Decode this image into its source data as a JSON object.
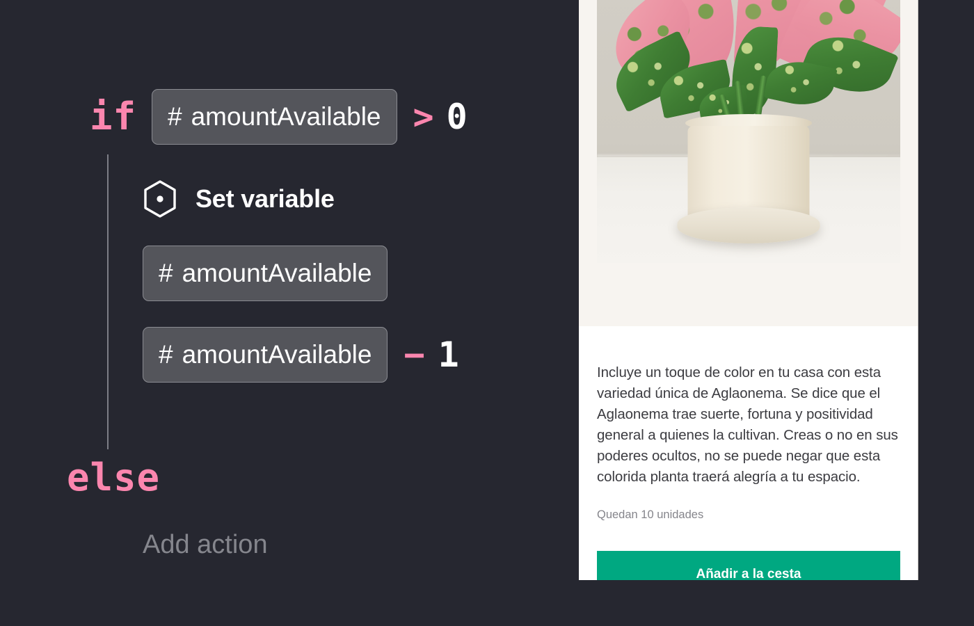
{
  "theme": {
    "background": "#262730",
    "keyword_color": "#fb86ae",
    "chip_background": "#54555b",
    "chip_border": "#8b8c92",
    "muted_text": "#85868d",
    "accent_green": "#00a881",
    "card_media_background": "#f7f4f0"
  },
  "flow": {
    "if_keyword": "if",
    "condition": {
      "variable_prefix": "#",
      "variable_name": "amountAvailable",
      "operator": ">",
      "value": "0"
    },
    "action": {
      "icon": "hexagon-dot-icon",
      "title": "Set variable",
      "target": {
        "variable_prefix": "#",
        "variable_name": "amountAvailable"
      },
      "expression": {
        "variable_prefix": "#",
        "variable_name": "amountAvailable",
        "operator": "−",
        "value": "1"
      }
    },
    "else_keyword": "else",
    "add_action_label": "Add action"
  },
  "product_card": {
    "image_alt": "aglaonema-pink-plant-photo",
    "description": "Incluye un toque de color en tu casa con esta variedad única de Aglaonema. Se dice que el Aglaonema trae suerte, fortuna y positividad general a quienes la cultivan. Creas o no en sus poderes ocultos, no se puede negar que esta colorida planta traerá alegría a tu espacio.",
    "stock_status": "Quedan 10 unidades",
    "cta_label": "Añadir a la cesta"
  }
}
